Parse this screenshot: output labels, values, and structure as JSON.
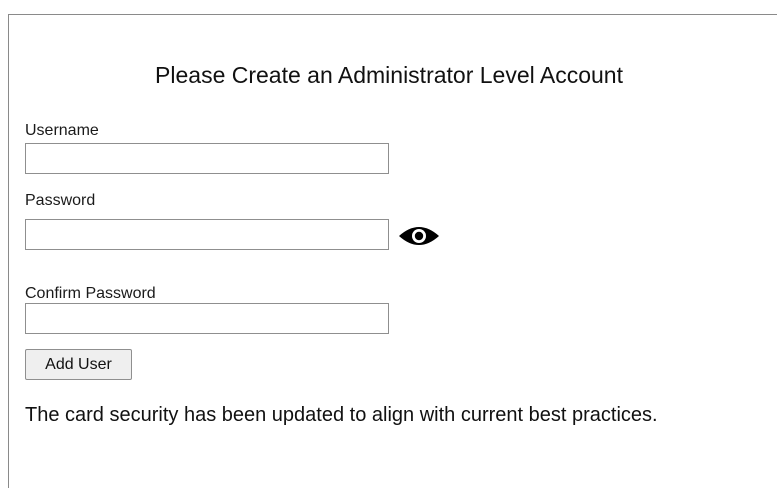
{
  "form": {
    "title": "Please Create an Administrator Level Account",
    "username": {
      "label": "Username",
      "value": "",
      "placeholder": ""
    },
    "password": {
      "label": "Password",
      "value": "",
      "placeholder": "",
      "toggle_icon": "eye-icon"
    },
    "confirm_password": {
      "label": "Confirm Password",
      "value": "",
      "placeholder": ""
    },
    "submit_label": "Add User",
    "message": "The card security has been updated to align with current best practices."
  }
}
